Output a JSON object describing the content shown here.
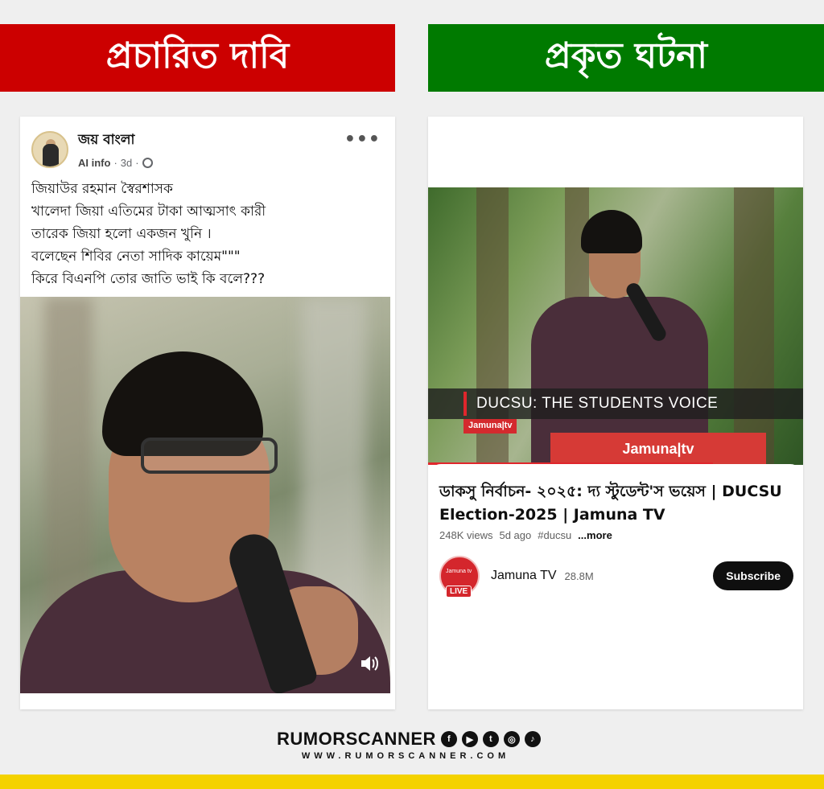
{
  "banners": {
    "claim": "প্রচারিত দাবি",
    "fact": "প্রকৃত ঘটনা"
  },
  "facebook_post": {
    "author": "জয় বাংলা",
    "ai_info": "AI info",
    "time": "3d",
    "more_icon": "more-dots-icon",
    "text_lines": [
      "জিয়াউর রহমান স্বৈরশাসক",
      "খালেদা জিয়া এতিমের টাকা আত্মসাৎ কারী",
      "তারেক জিয়া হলো একজন খুনি ।",
      "বলেছেন শিবির নেতা সাদিক কায়েম\"\"\"",
      "কিরে বিএনপি তোর জাতি ভাই কি বলে???"
    ]
  },
  "youtube": {
    "lower_third": "DUCSU: THE STUDENTS VOICE",
    "tag": "Jamuna|tv",
    "podium": "Jamuna|tv",
    "progress_fraction": 0.76,
    "title": "ডাকসু নির্বাচন- ২০২৫: দ্য স্টুডেন্ট'স ভয়েস | DUCSU Election-2025 | Jamuna TV",
    "views": "248K views",
    "age": "5d ago",
    "hashtag": "#ducsu",
    "more": "...more",
    "channel": {
      "name": "Jamuna TV",
      "subscribers": "28.8M",
      "logo_text": "Jamuna tv",
      "live": "LIVE"
    },
    "subscribe_label": "Subscribe"
  },
  "footer": {
    "brand": "RUMORSCANNER",
    "url": "WWW.RUMORSCANNER.COM",
    "social_icons": [
      "facebook-icon",
      "youtube-icon",
      "twitter-icon",
      "instagram-icon",
      "tiktok-icon"
    ]
  },
  "colors": {
    "claim_red": "#cc0000",
    "fact_green": "#007a00",
    "footer_yellow": "#f4d200"
  }
}
